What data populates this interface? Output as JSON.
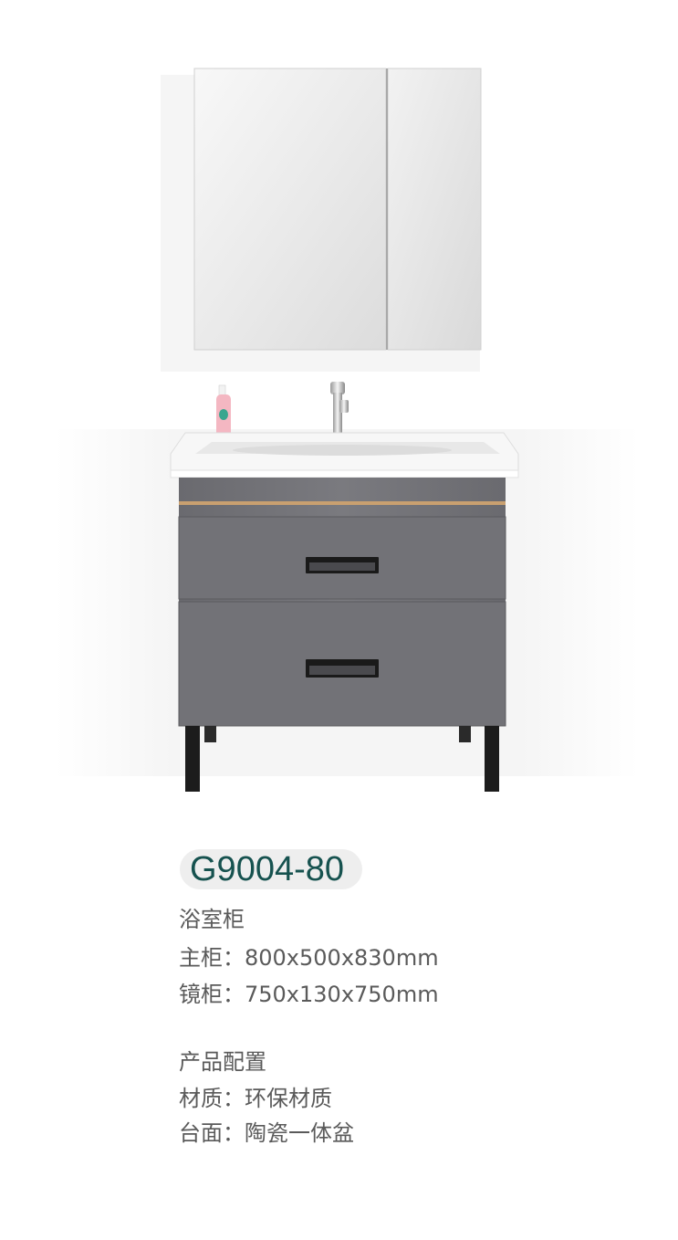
{
  "product": {
    "model": "G9004-80",
    "category": "浴室柜",
    "main_cabinet": "主柜：800x500x830mm",
    "mirror_cabinet": "镜柜：750x130x750mm"
  },
  "config": {
    "heading": "产品配置",
    "material": "材质：环保材质",
    "countertop": "台面：陶瓷一体盆"
  },
  "colors": {
    "model_text": "#16524f",
    "model_pill": "#eeeeee",
    "body_text": "#5a5a5a",
    "cabinet": "#6e6e73",
    "gold_trim": "#c9a070"
  }
}
